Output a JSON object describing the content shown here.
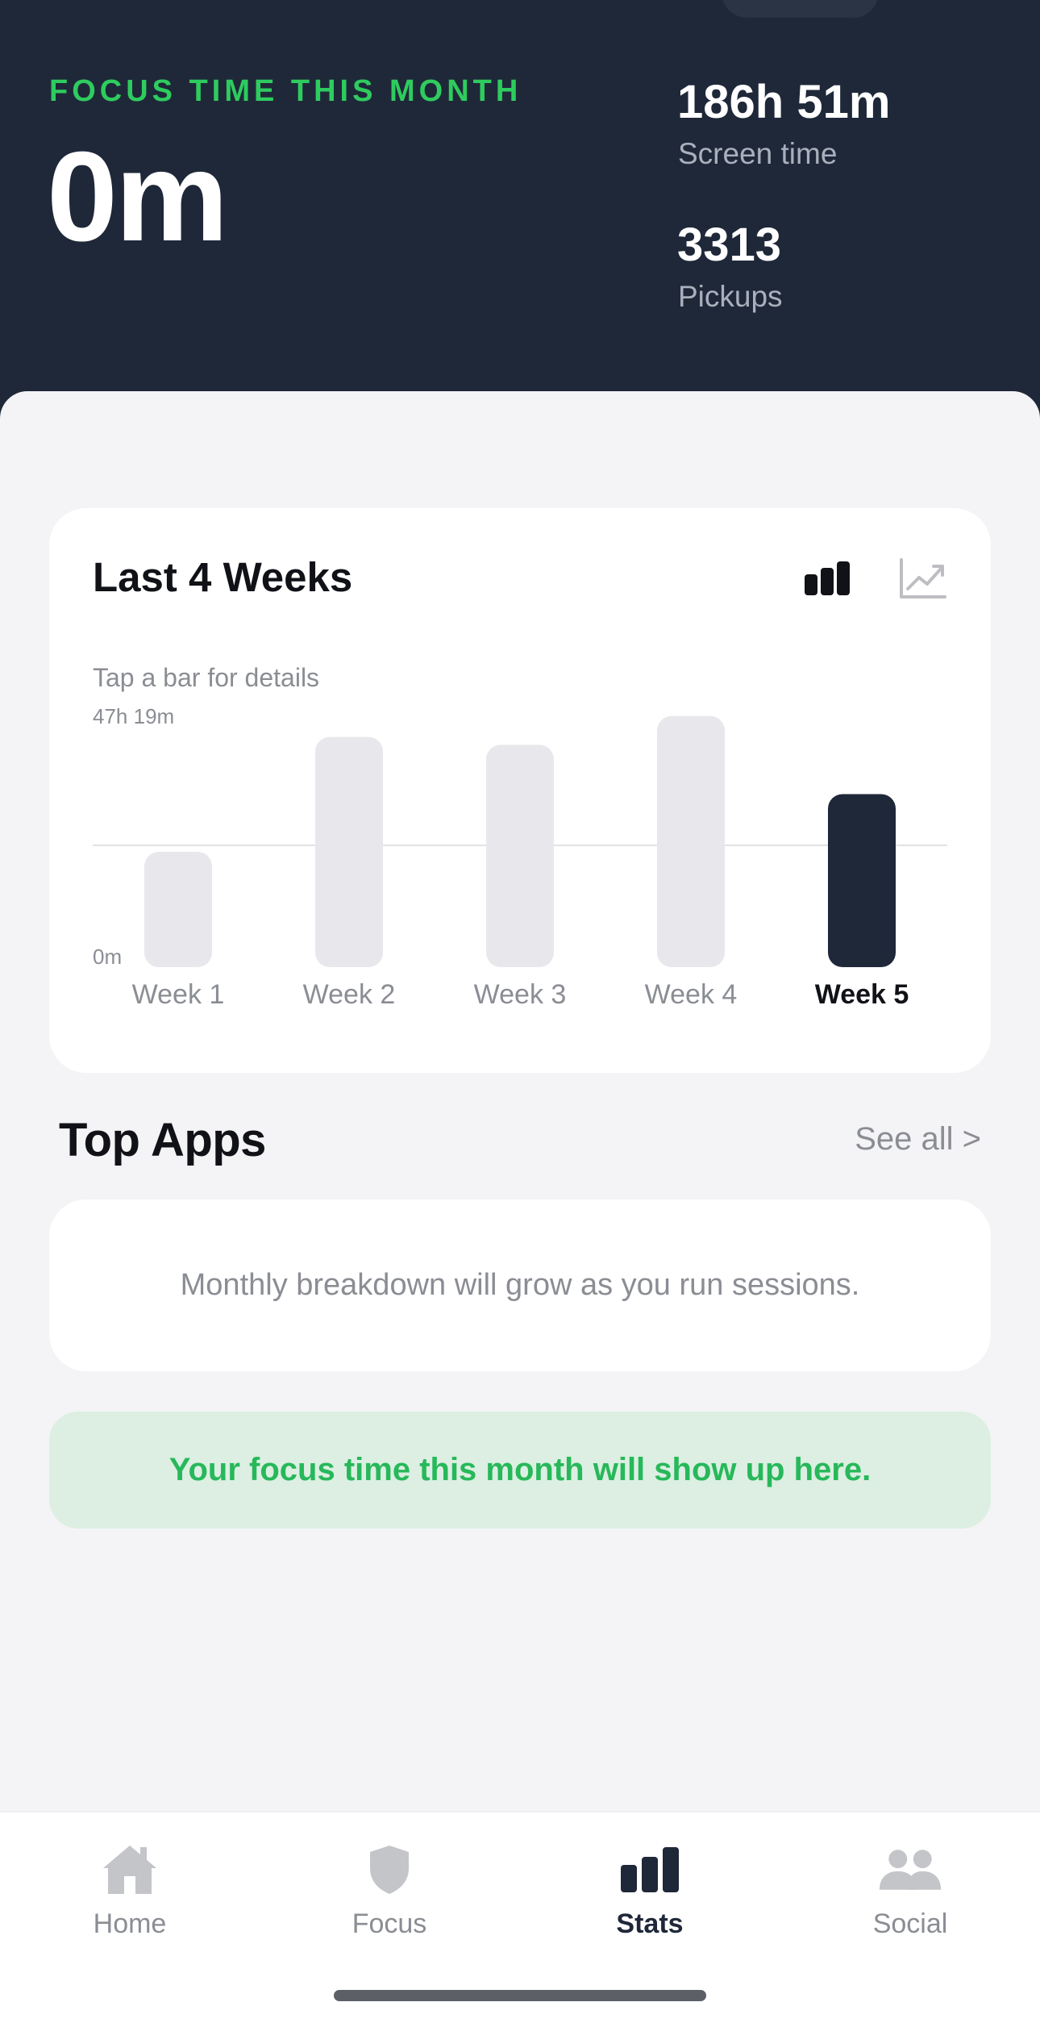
{
  "header": {
    "focus_label": "FOCUS TIME THIS MONTH",
    "focus_value": "0m",
    "screen_time_value": "186h 51m",
    "screen_time_label": "Screen time",
    "pickups_value": "3313",
    "pickups_label": "Pickups"
  },
  "chart_card": {
    "title": "Last 4 Weeks",
    "hint": "Tap a bar for details",
    "bar_view_icon": "bar-chart-icon",
    "line_view_icon": "line-chart-icon",
    "active_view": "bar"
  },
  "chart_data": {
    "type": "bar",
    "categories": [
      "Week 1",
      "Week 2",
      "Week 3",
      "Week 4",
      "Week 5"
    ],
    "values": [
      24.8,
      49.5,
      47.8,
      54.0,
      37.2
    ],
    "selected_index": 4,
    "y_tick_labels": {
      "top": "47h 19m",
      "bottom": "0m"
    },
    "ylim": [
      0,
      58.8
    ],
    "avg_line": 26.2,
    "unit": "hours",
    "colors": {
      "bar": "#E8E8EC",
      "selected": "#1F2839",
      "grid": "#E2E2E6"
    }
  },
  "top_apps": {
    "title": "Top Apps",
    "see_all": "See all >",
    "empty_message": "Monthly breakdown will grow as you run sessions."
  },
  "banner": {
    "message": "Your focus time this month will show up here."
  },
  "tabbar": {
    "items": [
      {
        "label": "Home",
        "icon": "home-icon"
      },
      {
        "label": "Focus",
        "icon": "shield-icon"
      },
      {
        "label": "Stats",
        "icon": "stats-icon"
      },
      {
        "label": "Social",
        "icon": "people-icon"
      }
    ],
    "active": "Stats"
  },
  "colors": {
    "header_bg": "#1F2839",
    "accent_green": "#2ECC5E",
    "banner_bg": "#DCEFE2"
  }
}
